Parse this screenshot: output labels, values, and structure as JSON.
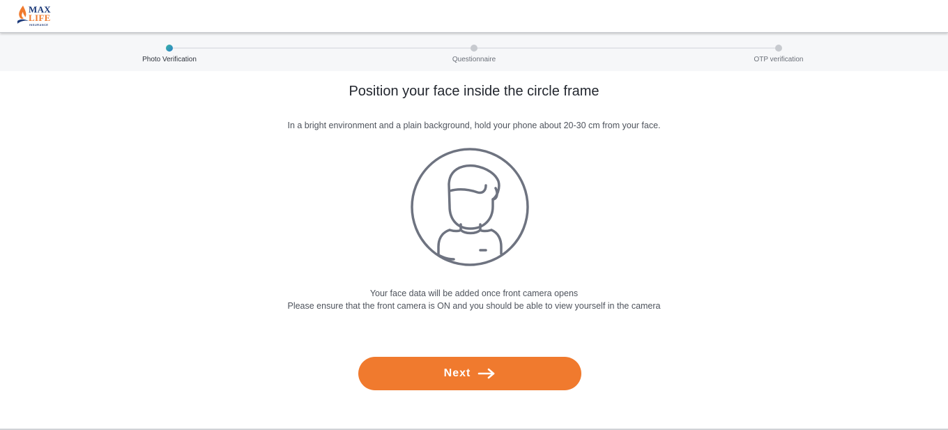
{
  "brand": {
    "logo_line1": "MAX",
    "logo_line2": "LIFE",
    "logo_line3": "INSURANCE",
    "orange": "#f07a2e",
    "navy": "#1d3a7a",
    "logo_icon": "flame-icon"
  },
  "stepper": {
    "steps": [
      {
        "label": "Photo Verification",
        "active": true
      },
      {
        "label": "Questionnaire",
        "active": false
      },
      {
        "label": "OTP verification",
        "active": false
      }
    ],
    "active_color": "#2a9fb6",
    "inactive_color": "#c7cacf"
  },
  "main": {
    "title": "Position your face inside the circle frame",
    "subtitle": "In a bright environment and a plain background, hold your phone about 20-30 cm from your face.",
    "illustration_icon": "face-frame-icon",
    "info_line1": "Your face data will be added once front camera opens",
    "info_line2": "Please ensure that the front camera is ON and you should be able to view yourself in the camera"
  },
  "actions": {
    "next_label": "Next",
    "next_icon": "arrow-right-icon",
    "button_color": "#f07a2e"
  }
}
